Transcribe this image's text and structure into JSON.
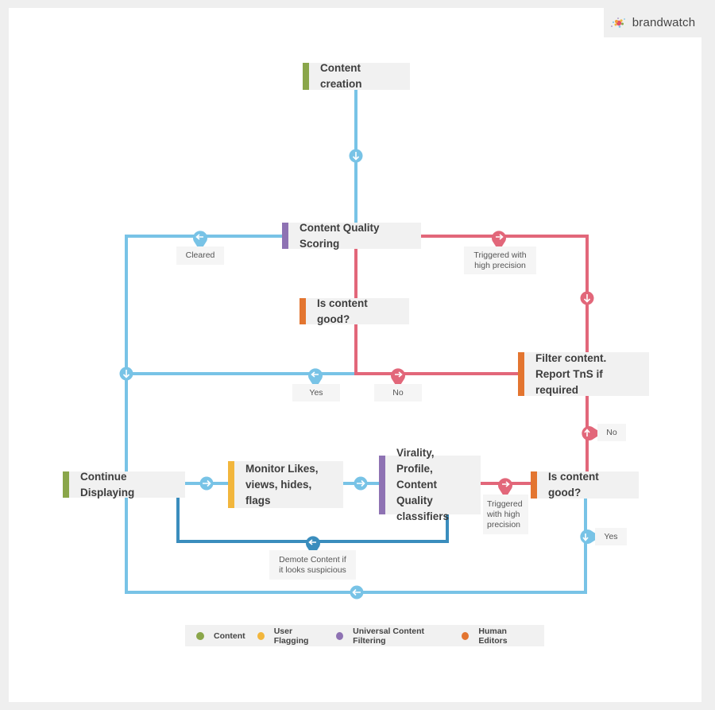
{
  "brand": {
    "name": "brandwatch",
    "logo_icon": "brandwatch-dots-logo"
  },
  "colors": {
    "content": "#8aa64a",
    "user_flagging": "#f2b63c",
    "universal_content_filtering": "#8e72b3",
    "human_editors": "#e37530",
    "flow_blue": "#78c3e6",
    "flow_red": "#e2677a",
    "flow_dark_blue": "#3a8dbd"
  },
  "nodes": {
    "content_creation": "Content creation",
    "content_quality_scoring": "Content Quality Scoring",
    "is_content_good_1": "Is content good?",
    "filter_content": [
      "Filter content.",
      "Report TnS if required"
    ],
    "continue_displaying": "Continue Displaying",
    "monitor": [
      "Monitor Likes,",
      "views, hides, flags"
    ],
    "classifiers": [
      "Virality, Profile,",
      "Content Quality",
      "classifiers"
    ],
    "is_content_good_2": "Is content good?"
  },
  "edge_labels": {
    "cleared": "Cleared",
    "triggered_top": [
      "Triggered with",
      "high precision"
    ],
    "yes_1": "Yes",
    "no_1": "No",
    "no_2": "No",
    "triggered_bottom": [
      "Triggered",
      "with high",
      "precision"
    ],
    "demote": [
      "Demote Content if",
      "it looks suspicious"
    ],
    "yes_2": "Yes"
  },
  "legend": [
    {
      "label": "Content",
      "color": "#8aa64a"
    },
    {
      "label": "User Flagging",
      "color": "#f2b63c"
    },
    {
      "label": "Universal Content Filtering",
      "color": "#8e72b3"
    },
    {
      "label": "Human Editors",
      "color": "#e37530"
    }
  ]
}
